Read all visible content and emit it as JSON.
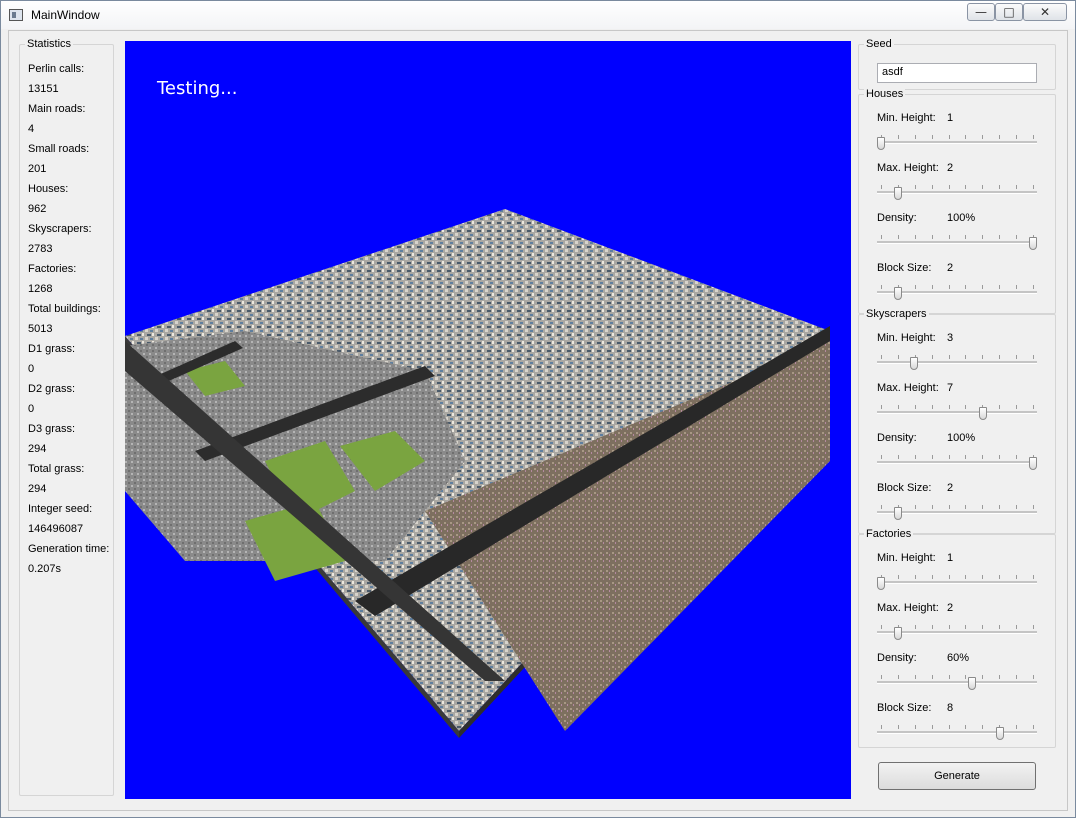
{
  "window": {
    "title": "MainWindow",
    "minimize": "—",
    "maximize": "□",
    "close": "✕"
  },
  "statistics": {
    "title": "Statistics",
    "items": [
      {
        "label": "Perlin calls:",
        "value": "13151"
      },
      {
        "label": "Main roads:",
        "value": "4"
      },
      {
        "label": "Small roads:",
        "value": "201"
      },
      {
        "label": "Houses:",
        "value": "962"
      },
      {
        "label": "Skyscrapers:",
        "value": "2783"
      },
      {
        "label": "Factories:",
        "value": "1268"
      },
      {
        "label": "Total buildings:",
        "value": "5013"
      },
      {
        "label": "D1 grass:",
        "value": "0"
      },
      {
        "label": "D2 grass:",
        "value": "0"
      },
      {
        "label": "D3 grass:",
        "value": "294"
      },
      {
        "label": "Total grass:",
        "value": "294"
      },
      {
        "label": "Integer seed:",
        "value": "146496087"
      },
      {
        "label": "Generation time:",
        "value": "0.207s"
      }
    ]
  },
  "viewport": {
    "overlay_text": "Testing...",
    "background": "#0000ff"
  },
  "seed": {
    "title": "Seed",
    "value": "asdf"
  },
  "houses": {
    "title": "Houses",
    "rows": [
      {
        "label": "Min. Height:",
        "value": "1",
        "level": 0.0
      },
      {
        "label": "Max. Height:",
        "value": "2",
        "level": 0.11
      },
      {
        "label": "Density:",
        "value": "100%",
        "level": 1.0
      },
      {
        "label": "Block Size:",
        "value": "2",
        "level": 0.11
      }
    ]
  },
  "skyscrapers": {
    "title": "Skyscrapers",
    "rows": [
      {
        "label": "Min. Height:",
        "value": "3",
        "level": 0.22
      },
      {
        "label": "Max. Height:",
        "value": "7",
        "level": 0.67
      },
      {
        "label": "Density:",
        "value": "100%",
        "level": 1.0
      },
      {
        "label": "Block Size:",
        "value": "2",
        "level": 0.11
      }
    ]
  },
  "factories": {
    "title": "Factories",
    "rows": [
      {
        "label": "Min. Height:",
        "value": "1",
        "level": 0.0
      },
      {
        "label": "Max. Height:",
        "value": "2",
        "level": 0.11
      },
      {
        "label": "Density:",
        "value": "60%",
        "level": 0.6
      },
      {
        "label": "Block Size:",
        "value": "8",
        "level": 0.78
      }
    ]
  },
  "generate_label": "Generate"
}
